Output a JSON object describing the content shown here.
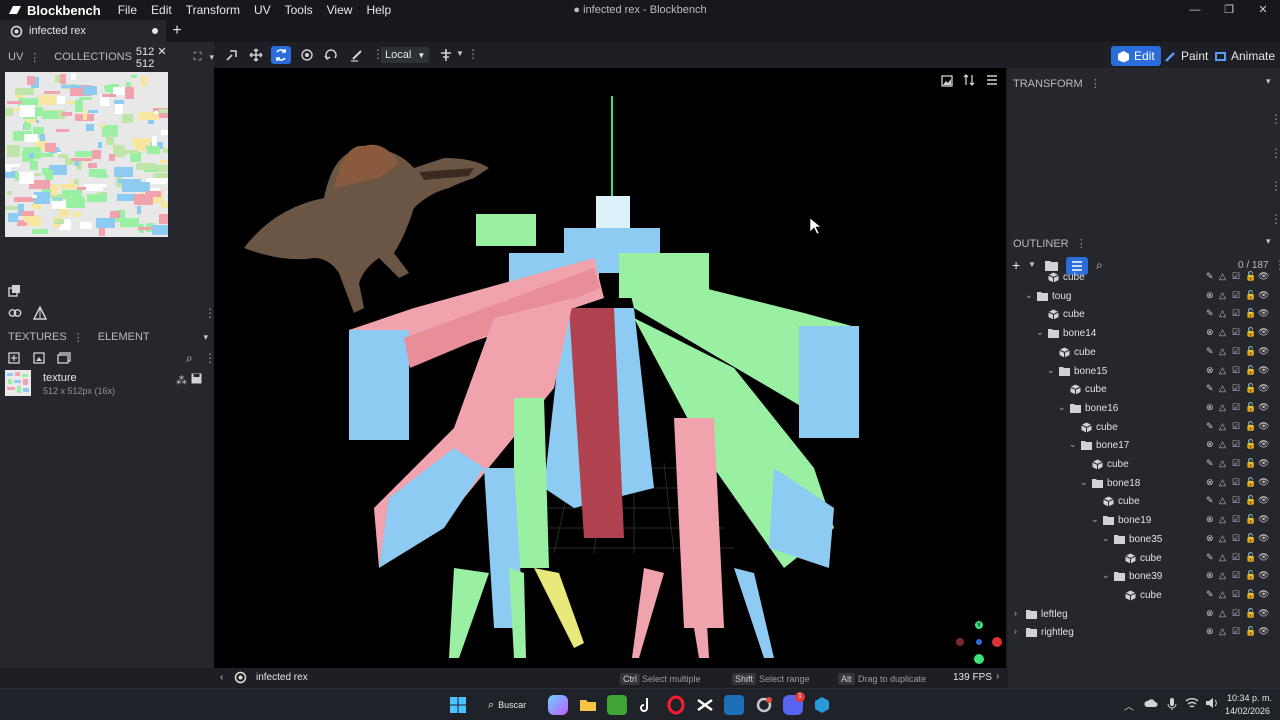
{
  "app": {
    "name": "Blockbench",
    "window_title": "● infected rex - Blockbench",
    "menu": [
      "File",
      "Edit",
      "Transform",
      "UV",
      "Tools",
      "View",
      "Help"
    ]
  },
  "tabs": [
    {
      "label": "infected rex"
    }
  ],
  "left_panel": {
    "uv_label": "UV",
    "collections_label": "COLLECTIONS",
    "uv_size": "512 ✕ 512",
    "textures_label": "TEXTURES",
    "element_label": "ELEMENT",
    "texture": {
      "name": "texture",
      "size": "512 x 512px (16x)"
    }
  },
  "toolbar": {
    "space_select": "Local"
  },
  "modes": {
    "edit": "Edit",
    "paint": "Paint",
    "animate": "Animate"
  },
  "right_panel": {
    "transform_label": "TRANSFORM",
    "outliner_label": "OUTLINER",
    "count": "0 / 187",
    "items": [
      {
        "label": "cube",
        "kind": "cube",
        "depth": 2
      },
      {
        "label": "toug",
        "kind": "group",
        "depth": 1,
        "expanded": true
      },
      {
        "label": "cube",
        "kind": "cube",
        "depth": 2
      },
      {
        "label": "bone14",
        "kind": "group",
        "depth": 2,
        "expanded": true
      },
      {
        "label": "cube",
        "kind": "cube",
        "depth": 3
      },
      {
        "label": "bone15",
        "kind": "group",
        "depth": 3,
        "expanded": true
      },
      {
        "label": "cube",
        "kind": "cube",
        "depth": 4
      },
      {
        "label": "bone16",
        "kind": "group",
        "depth": 4,
        "expanded": true
      },
      {
        "label": "cube",
        "kind": "cube",
        "depth": 5
      },
      {
        "label": "bone17",
        "kind": "group",
        "depth": 5,
        "expanded": true
      },
      {
        "label": "cube",
        "kind": "cube",
        "depth": 6
      },
      {
        "label": "bone18",
        "kind": "group",
        "depth": 6,
        "expanded": true
      },
      {
        "label": "cube",
        "kind": "cube",
        "depth": 7
      },
      {
        "label": "bone19",
        "kind": "group",
        "depth": 7,
        "expanded": true
      },
      {
        "label": "bone35",
        "kind": "group",
        "depth": 8,
        "expanded": true
      },
      {
        "label": "cube",
        "kind": "cube",
        "depth": 9
      },
      {
        "label": "bone39",
        "kind": "group",
        "depth": 8,
        "expanded": true
      },
      {
        "label": "cube",
        "kind": "cube",
        "depth": 9
      },
      {
        "label": "leftleg",
        "kind": "group",
        "depth": 0,
        "expanded": false
      },
      {
        "label": "rightleg",
        "kind": "group",
        "depth": 0,
        "expanded": false
      }
    ]
  },
  "statusbar": {
    "project": "infected rex",
    "ctrl_key": "Ctrl",
    "ctrl_hint": "Select multiple",
    "shift_key": "Shift",
    "shift_hint": "Select range",
    "alt_key": "Alt",
    "alt_hint": "Drag to duplicate",
    "fps": "139 FPS"
  },
  "taskbar": {
    "search_label": "Buscar",
    "time": "10:34 p. m.",
    "date": "14/02/2026",
    "discord_badge": "1"
  },
  "colors": {
    "accent": "#2a6ddb",
    "model_blue": "#8ecbf2",
    "model_red": "#f0a3ad",
    "model_green": "#9af0a2"
  }
}
